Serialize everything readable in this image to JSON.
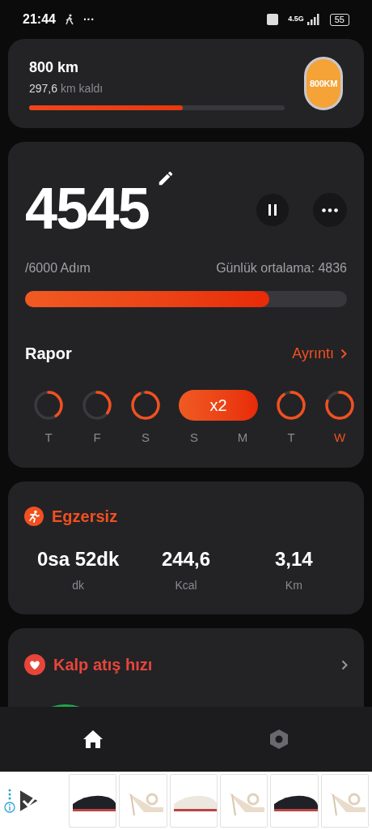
{
  "status_bar": {
    "time": "21:44",
    "more": "···",
    "network": "4.5G",
    "battery": "55"
  },
  "goal_card": {
    "title": "800 km",
    "remaining_value": "297,6",
    "remaining_unit": "km kaldı",
    "level": 0.6,
    "badge": "800KM"
  },
  "steps_card": {
    "steps": "4545",
    "goal": "/6000 Adım",
    "average": "Günlük ortalama: 4836",
    "level": 0.76,
    "report_title": "Rapor",
    "details_link": "Ayrıntı",
    "days": [
      {
        "kind": "ring"
      },
      {
        "kind": "ring"
      },
      {
        "kind": "ring"
      },
      {
        "kind": "pill",
        "text": "x2"
      },
      {
        "kind": "ring"
      },
      {
        "kind": "ring"
      }
    ],
    "day_labels": [
      {
        "label": "T",
        "selected": false
      },
      {
        "label": "F",
        "selected": false
      },
      {
        "label": "S",
        "selected": false
      },
      {
        "label": "S",
        "selected": false
      },
      {
        "label": "M",
        "selected": false
      },
      {
        "label": "T",
        "selected": false
      },
      {
        "label": "W",
        "selected": true
      }
    ]
  },
  "exercise_card": {
    "title": "Egzersiz",
    "stats": [
      {
        "value": "0sa 52dk",
        "unit": "dk"
      },
      {
        "value": "244,6",
        "unit": "Kcal"
      },
      {
        "value": "3,14",
        "unit": "Km"
      }
    ]
  },
  "heart_card": {
    "title": "Kalp atış hızı"
  },
  "nav": [
    {
      "kind": "home",
      "selected": true
    },
    {
      "kind": "settings",
      "selected": false
    }
  ]
}
